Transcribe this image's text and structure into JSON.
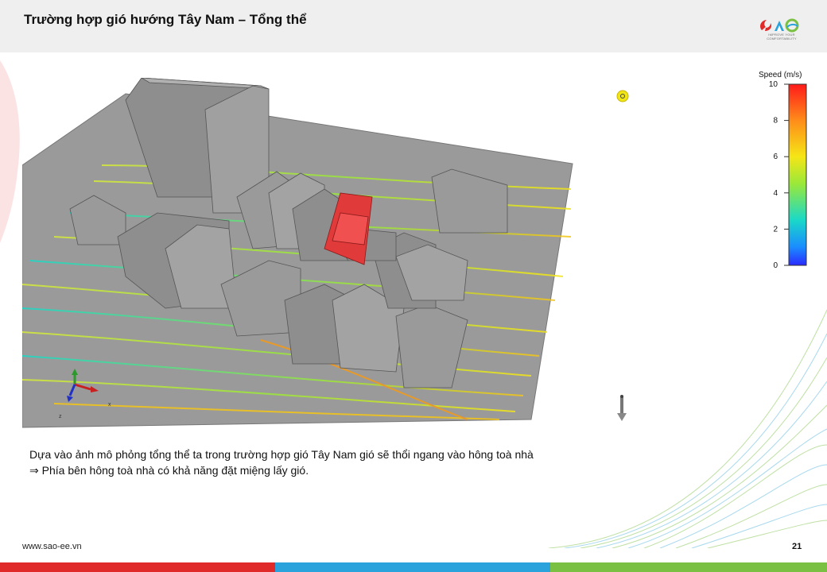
{
  "slide": {
    "title": "Trường hợp gió hướng Tây Nam – Tổng thể",
    "page_number": "21",
    "website": "www.sao-ee.vn"
  },
  "logo": {
    "name": "SAO",
    "tagline": "IMPROVE YOUR COMFORTABILITY"
  },
  "legend": {
    "title": "Speed (m/s)",
    "ticks": [
      "10",
      "8",
      "6",
      "4",
      "2",
      "0"
    ],
    "min": 0,
    "max": 10,
    "colors": [
      "#ff1a1a",
      "#ff8c1a",
      "#f5e616",
      "#9ae83a",
      "#1ad9c8",
      "#1a8cff",
      "#2a2aff"
    ]
  },
  "description": {
    "line1": "Dựa vào ảnh mô phỏng tổng thể ta trong trường hợp gió Tây Nam gió sẽ thổi ngang vào hông toà nhà",
    "arrow": "⇒",
    "line2": " Phía bên hông toà nhà có khả năng đặt miệng lấy gió."
  },
  "axes": {
    "z": "z",
    "x": "x"
  },
  "colors": {
    "bar_red": "#e02a2a",
    "bar_blue": "#2aa3dc",
    "bar_green": "#7ac043",
    "building": "#8e8e8e",
    "ground": "#9a9a9a",
    "highlight_building": "#e03a3a"
  }
}
